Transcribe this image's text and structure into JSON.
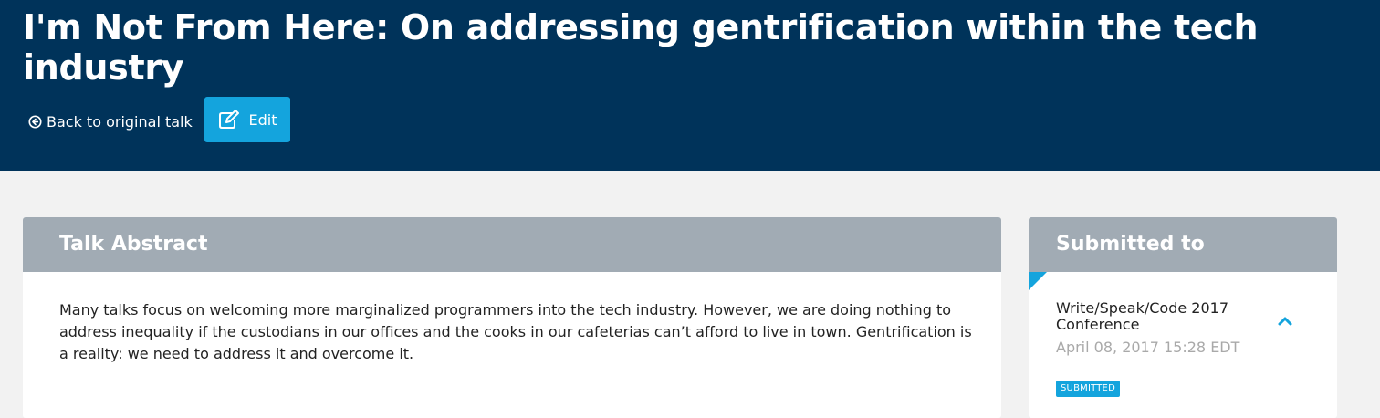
{
  "header": {
    "title": "I'm Not From Here: On addressing gentrification within the tech industry",
    "back_link": "Back to original talk",
    "edit_label": "Edit",
    "background_color": "#00335a",
    "accent_color": "#14a4dd"
  },
  "abstract": {
    "heading": "Talk Abstract",
    "text": "Many talks focus on welcoming more marginalized programmers into the tech industry. However, we are doing nothing to address inequality if the custodians in our offices and the cooks in our cafeterias can’t afford to live in town. Gentrification is a reality: we need to address it and overcome it."
  },
  "submitted": {
    "heading": "Submitted to",
    "conference": "Write/Speak/Code 2017 Conference",
    "date": "April 08, 2017 15:28 EDT",
    "status": "SUBMITTED",
    "toggle_icon": "chevron-up-icon"
  },
  "icons": {
    "back": "circle-arrow-left-icon",
    "edit": "edit-pencil-icon"
  }
}
